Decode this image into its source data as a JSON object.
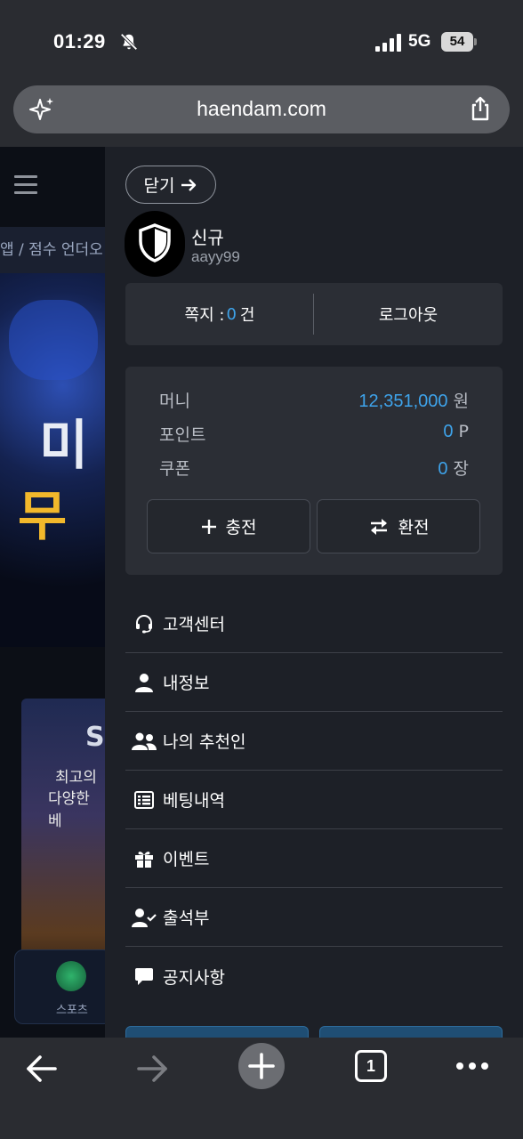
{
  "status_bar": {
    "time": "01:29",
    "network": "5G",
    "battery": "54"
  },
  "browser": {
    "url": "haendam.com",
    "tab_count": "1"
  },
  "background_page": {
    "marquee": "앱 / 점수 언더오",
    "banner_line1": "미",
    "banner_line2": "무",
    "banner2_title": "S",
    "banner2_line1": "최고의",
    "banner2_line2": "다양한 베",
    "sports_label": "스포츠"
  },
  "drawer": {
    "close_label": "닫기",
    "user": {
      "grade": "신규",
      "id": "aayy99"
    },
    "messages": {
      "label": "쪽지 : ",
      "count": "0",
      "unit": "건"
    },
    "logout_label": "로그아웃",
    "wallet": {
      "money": {
        "label": "머니",
        "value": "12,351,000",
        "unit": "원"
      },
      "points": {
        "label": "포인트",
        "value": "0",
        "unit": "P"
      },
      "coupons": {
        "label": "쿠폰",
        "value": "0",
        "unit": "장"
      },
      "deposit_label": "충전",
      "exchange_label": "환전"
    },
    "menu": [
      {
        "label": "고객센터",
        "icon": "headset-icon"
      },
      {
        "label": "내정보",
        "icon": "user-icon"
      },
      {
        "label": "나의 추천인",
        "icon": "users-icon"
      },
      {
        "label": "베팅내역",
        "icon": "list-icon"
      },
      {
        "label": "이벤트",
        "icon": "gift-icon"
      },
      {
        "label": "출석부",
        "icon": "user-check-icon"
      },
      {
        "label": "공지사항",
        "icon": "comment-icon"
      }
    ]
  },
  "colors": {
    "accent_blue": "#3ea3ea",
    "drawer_bg": "#1d2027",
    "panel_bg": "#2b2e35"
  }
}
